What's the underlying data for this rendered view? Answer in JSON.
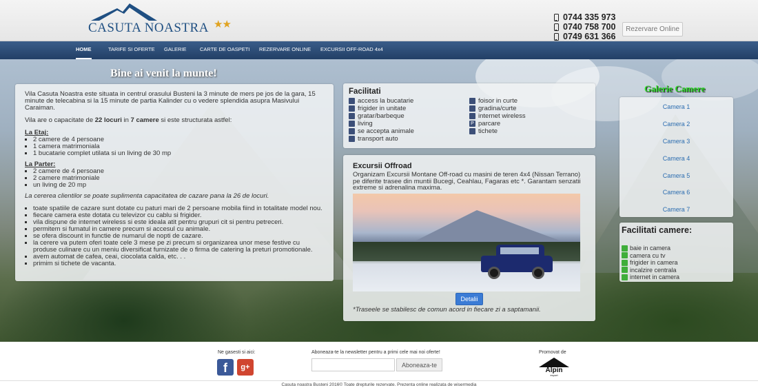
{
  "header": {
    "logo_text": "CASUTA NOASTRA",
    "logo_stars": "★★",
    "phones": [
      "0744 335 973",
      "0740 758 700",
      "0749 631 366"
    ],
    "rezervare_button": "Rezervare Online"
  },
  "nav": {
    "items": [
      {
        "label": "HOME",
        "active": true
      },
      {
        "label": "TARIFE SI OFERTE"
      },
      {
        "label": "GALERIE"
      },
      {
        "label": "CARTE DE OASPETI"
      },
      {
        "label": "REZERVARE ONLINE"
      },
      {
        "label": "EXCURSII OFF-ROAD 4x4"
      }
    ]
  },
  "welcome": "Bine ai venit la munte!",
  "intro": {
    "p1": "Vila Casuta Noastra este situata in centrul orasului Busteni la 3 minute de mers pe jos de la gara, 15 minute de telecabina si la 15 minute de partia Kalinder cu o vedere splendida asupra Masivului Caraiman.",
    "p2_pre": "Vila are o capacitate de ",
    "p2_locuri": "22 locuri",
    "p2_mid": " in ",
    "p2_camere": "7 camere",
    "p2_post": " si este structurata astfel:",
    "etaj_title": "La Etaj:",
    "etaj": [
      "2 camere de 4 persoane",
      "1 camera matrimoniala",
      "1 bucatarie complet utilata si un living de 30 mp"
    ],
    "parter_title": "La Parter:",
    "parter": [
      "2 camere de 4 persoane",
      "2 camere matrimoniale",
      "un living de 20 mp"
    ],
    "note": "La cererea clientilor se poate suplimenta capacitatea de cazare pana la 26 de locuri.",
    "features": [
      "toate spatiile de cazare sunt dotate cu paturi mari de 2 persoane mobila fiind in totalitate model nou.",
      "fiecare camera este dotata cu televizor cu cablu si frigider.",
      "vila dispune de internet wireless si este ideala atit pentru grupuri cit si pentru petreceri.",
      "permitem si fumatul in camere precum si accesul cu animale.",
      "se ofera discount in functie de numarul de nopti de cazare.",
      "la cerere va putem oferi toate cele 3 mese pe zi precum si organizarea unor mese festive cu produse culinare cu un meniu diversificat furnizate de o firma de catering la preturi promotionale.",
      "avem automat de cafea, ceai, ciocolata calda, etc. . .",
      "primim si tichete de vacanta."
    ]
  },
  "facilitati": {
    "title": "Facilitati",
    "col1": [
      "access la bucatarie",
      "frigider in unitate",
      "gratar/barbeque",
      "living",
      "se accepta animale",
      "transport auto"
    ],
    "col2": [
      "foisor in curte",
      "gradina/curte",
      "internet wireless",
      "parcare",
      "tichete"
    ]
  },
  "offroad": {
    "title": "Excursii Offroad",
    "text": "Organizam Excursii Montane Off-road cu masini de teren 4x4 (Nissan Terrano) pe diferite trasee din muntii Bucegi, Ceahlau, Fagaras etc *. Garantam senzatii extreme si adrenalina maxima.",
    "button": "Detalii",
    "caption": "*Traseele se stabilesc de comun acord in fiecare zi a saptamanii."
  },
  "galerie": {
    "title": "Galerie Camere",
    "items": [
      "Camera 1",
      "Camera 2",
      "Camera 3",
      "Camera 4",
      "Camera 5",
      "Camera 6",
      "Camera 7"
    ]
  },
  "facilitati_camere": {
    "title": "Facilitati camere:",
    "items": [
      "baie in camera",
      "camera cu tv",
      "frigider in camera",
      "incalzire centrala",
      "internet in camera"
    ]
  },
  "footer": {
    "social_label": "Ne gasesti si aici:",
    "newsletter_label": "Aboneaza-te la newsletter pentru a primi cele mai noi oferte!",
    "newsletter_button": "Aboneaza-te",
    "promo_label": "Promovat de",
    "promo_logo": "Alpin",
    "promo_logo_sub": "export",
    "copyright": "Casuta noastra Busteni 2016© Toate drepturile rezervate. Prezenta online realizata de wisermedia"
  },
  "colors": {
    "brand": "#1f4f82",
    "nav": "#2b4a73",
    "stars": "#e0a321",
    "gallery_title": "#2fe02a",
    "button": "#3a7bd5"
  }
}
